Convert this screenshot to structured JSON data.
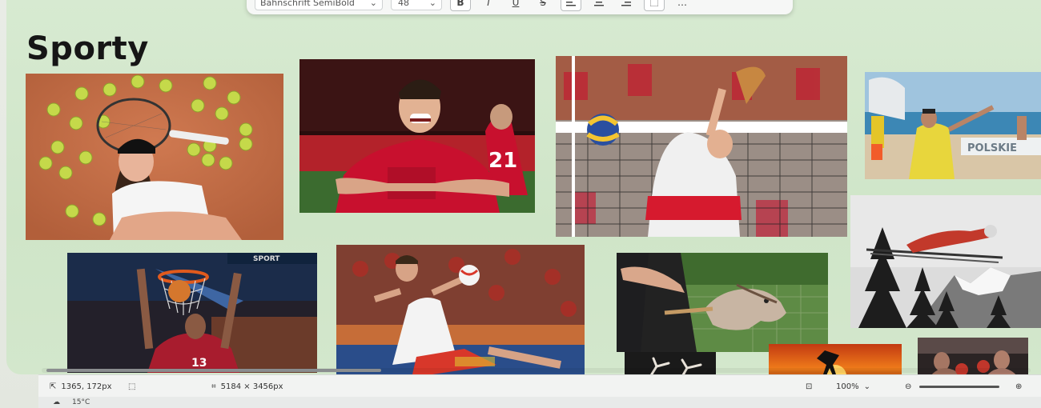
{
  "toolbar": {
    "font_family": "Bahnschrift SemiBold",
    "font_size": "48",
    "bold_label": "B",
    "italic_label": "I",
    "underline_label": "U",
    "strike_label": "S"
  },
  "slide": {
    "title": "Sporty"
  },
  "photos": [
    {
      "subject": "tennis player with tennis balls"
    },
    {
      "subject": "football player in red jersey"
    },
    {
      "subject": "volleyball player at the net"
    },
    {
      "subject": "beach volleyball player",
      "banner": "POLSKIE"
    },
    {
      "subject": "basketball dunk",
      "jersey_number": "13"
    },
    {
      "subject": "handball player"
    },
    {
      "subject": "hobby horse riding"
    },
    {
      "subject": "ski jumper"
    },
    {
      "subject": "martial arts silhouette at sunset"
    },
    {
      "subject": "boxers"
    },
    {
      "subject": "gymnasts"
    }
  ],
  "status": {
    "cursor_position": "1365, 172px",
    "image_size": "5184 × 3456px",
    "zoom": "100%",
    "temperature": "15°C"
  },
  "colors": {
    "canvas_bg": "#d3e8cc",
    "title_color": "#161616",
    "sport_red": "#c8102e"
  }
}
